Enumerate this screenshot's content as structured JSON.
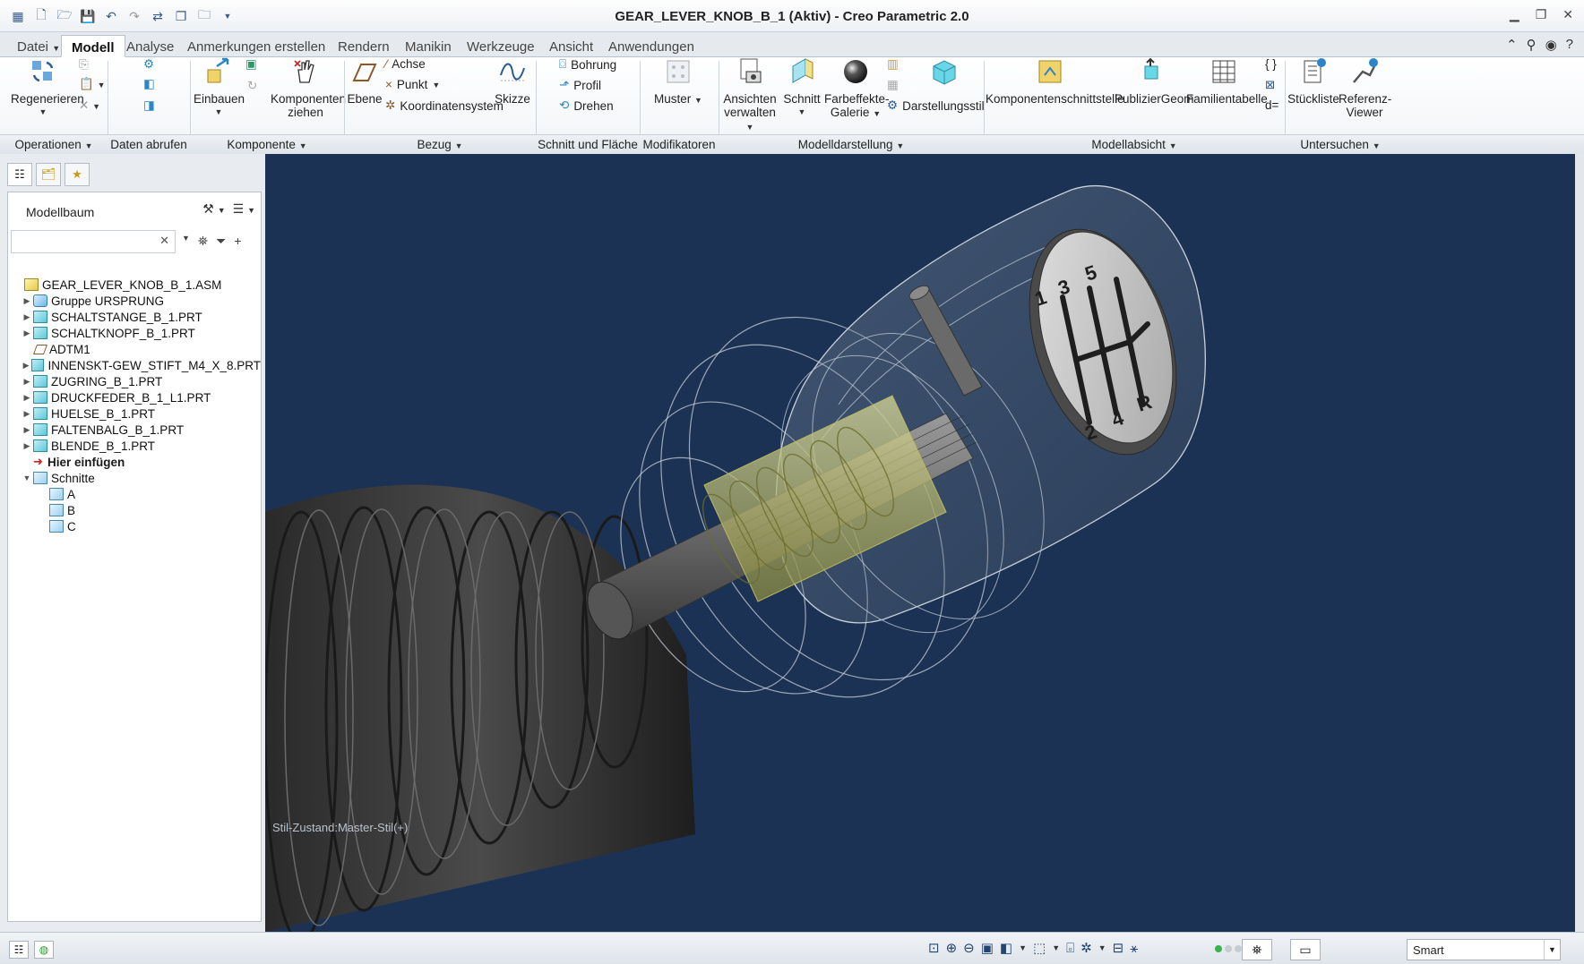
{
  "window": {
    "title": "GEAR_LEVER_KNOB_B_1 (Aktiv) - Creo Parametric 2.0"
  },
  "tabs": [
    "Datei",
    "Modell",
    "Analyse",
    "Anmerkungen erstellen",
    "Rendern",
    "Manikin",
    "Werkzeuge",
    "Ansicht",
    "Anwendungen"
  ],
  "ribbon": {
    "buttons": {
      "regenerieren": "Regenerieren",
      "einbauen": "Einbauen",
      "komponenten_ziehen_1": "Komponenten",
      "komponenten_ziehen_2": "ziehen",
      "ebene": "Ebene",
      "achse": "Achse",
      "punkt": "Punkt",
      "koordinatensystem": "Koordinatensystem",
      "skizze": "Skizze",
      "bohrung": "Bohrung",
      "profil": "Profil",
      "drehen": "Drehen",
      "muster": "Muster",
      "ansichten_1": "Ansichten",
      "ansichten_2": "verwalten",
      "schnitt": "Schnitt",
      "farbeffekte_1": "Farbeffekte-",
      "farbeffekte_2": "Galerie",
      "darstellungsstil": "Darstellungsstil",
      "komponentenschnittstelle": "Komponentenschnittstelle",
      "publiziergeom": "PublizierGeom",
      "familientabelle": "Familientabelle",
      "stueckliste": "Stückliste",
      "referenz_1": "Referenz-",
      "referenz_2": "Viewer",
      "d_eq": "d="
    },
    "groups": {
      "operationen": "Operationen",
      "daten_abrufen": "Daten abrufen",
      "komponente": "Komponente",
      "bezug": "Bezug",
      "schnitt_flaeche": "Schnitt und Fläche",
      "modifikatoren": "Modifikatoren",
      "modelldarstellung": "Modelldarstellung",
      "modellabsicht": "Modellabsicht",
      "untersuchen": "Untersuchen"
    }
  },
  "model_tree": {
    "header": "Modellbaum",
    "search_value": "",
    "items": [
      {
        "label": "GEAR_LEVER_KNOB_B_1.ASM",
        "icon": "assembly-icon"
      },
      {
        "label": "Gruppe URSPRUNG",
        "icon": "group-icon"
      },
      {
        "label": "SCHALTSTANGE_B_1.PRT",
        "icon": "part-icon"
      },
      {
        "label": "SCHALTKNOPF_B_1.PRT",
        "icon": "part-icon"
      },
      {
        "label": "ADTM1",
        "icon": "datum-plane-icon"
      },
      {
        "label": "INNENSKT-GEW_STIFT_M4_X_8.PRT",
        "icon": "part-icon"
      },
      {
        "label": "ZUGRING_B_1.PRT",
        "icon": "part-icon"
      },
      {
        "label": "DRUCKFEDER_B_1_L1.PRT",
        "icon": "part-icon"
      },
      {
        "label": "HUELSE_B_1.PRT",
        "icon": "part-icon"
      },
      {
        "label": "FALTENBALG_B_1.PRT",
        "icon": "part-icon"
      },
      {
        "label": "BLENDE_B_1.PRT",
        "icon": "part-icon"
      },
      {
        "label": "Hier einfügen",
        "icon": "insert-arrow-icon"
      },
      {
        "label": "Schnitte",
        "icon": "sections-icon"
      },
      {
        "label": "A",
        "icon": "section-icon"
      },
      {
        "label": "B",
        "icon": "section-icon"
      },
      {
        "label": "C",
        "icon": "section-icon"
      }
    ]
  },
  "viewport": {
    "style_state": "Stil-Zustand:Master-Stil(+)",
    "knob_digits": [
      "1",
      "3",
      "5",
      "2",
      "4",
      "R"
    ],
    "background_color": "#1c3254"
  },
  "statusbar": {
    "filter_value": "Smart"
  }
}
